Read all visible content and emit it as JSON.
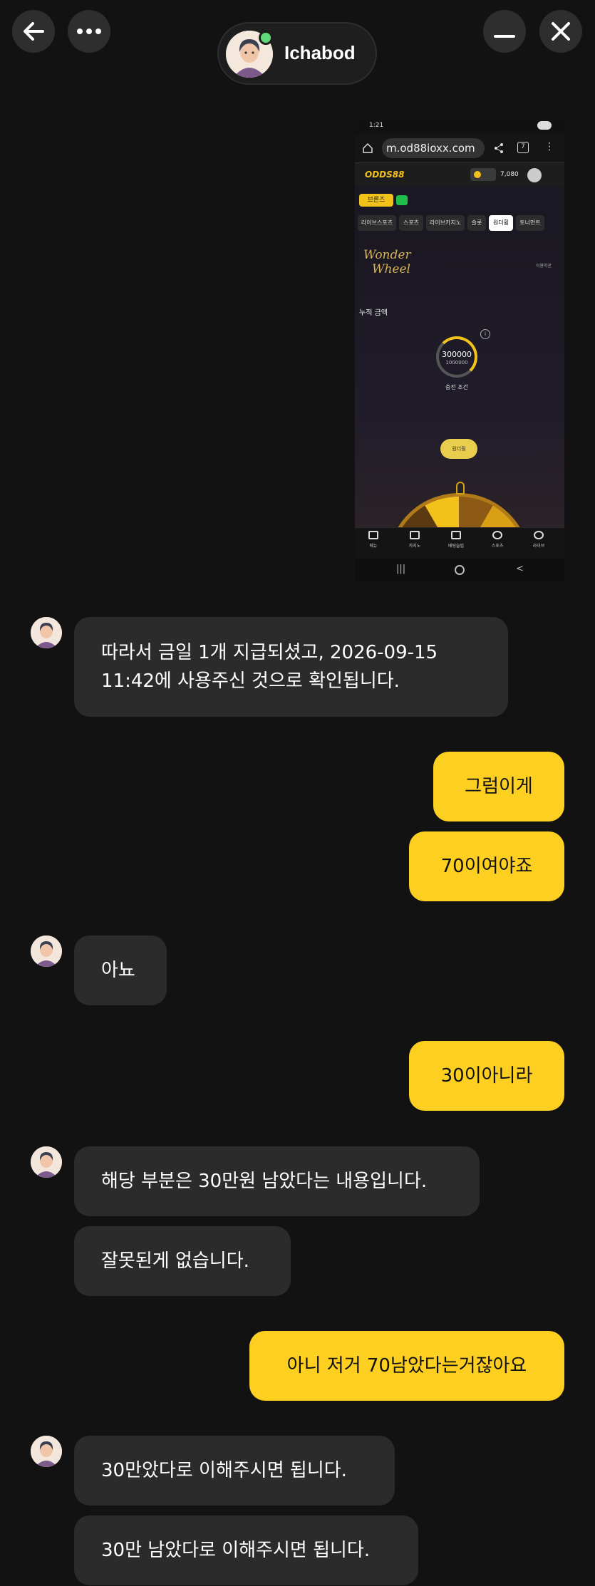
{
  "header": {
    "contact_name": "Ichabod",
    "status_color": "#5fd97a",
    "back_icon": "arrow-left-icon",
    "more_icon": "more-horizontal-icon",
    "minimize_icon": "minimize-icon",
    "close_icon": "close-icon"
  },
  "attachment": {
    "status_time": "1:21",
    "url": "m.od88ioxx.com",
    "tab_count": "7",
    "site_logo": "ODDS88",
    "balance": "7,080",
    "badge": "브론즈",
    "tabs": [
      "라이브스포츠",
      "스포츠",
      "라이브카지노",
      "슬롯",
      "원더휠",
      "토너먼트"
    ],
    "promo_title_1": "Wonder",
    "promo_title_2": "Wheel",
    "small_note": "이용약관",
    "accumulated_label": "누적 금액",
    "ring_value": "300000",
    "ring_target": "1000000",
    "ring_progress": 0.3,
    "charge_condition": "충전 조건",
    "spin_button": "원더휠",
    "bottom_nav": [
      "메뉴",
      "카지노",
      "베팅슬립",
      "스포츠",
      "라이브"
    ]
  },
  "messages": {
    "m1_line1": "따라서 금일 1개 지급되셨고, 2026-09-15",
    "m1_line2": "11:42에 사용주신 것으로 확인됩니다.",
    "m2": "그럼이게",
    "m3": "70이여야죠",
    "m4": "아뇨",
    "m5": "30이아니라",
    "m6": "해당 부분은 30만원 남았다는 내용입니다.",
    "m7": "잘못된게 없습니다.",
    "m8": "아니 저거 70남았다는거잖아요",
    "m9": "30만았다로 이해주시면 됩니다.",
    "m10": "30만 남았다로 이해주시면 됩니다."
  },
  "colors": {
    "background": "#121212",
    "incoming_bubble": "#2b2b2b",
    "outgoing_bubble": "#fccf21",
    "accent_gold": "#f2c21b"
  }
}
